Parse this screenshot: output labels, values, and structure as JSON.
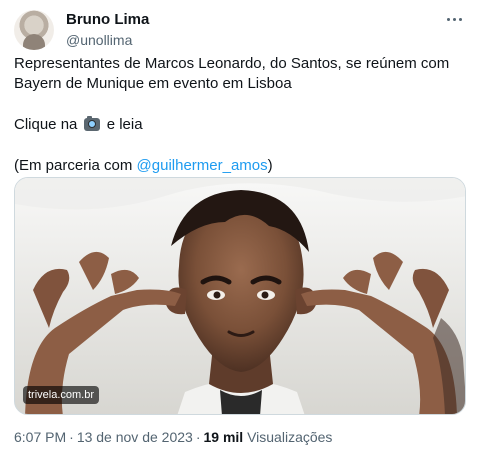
{
  "post": {
    "author_name": "Bruno Lima",
    "author_handle": "@unollima",
    "text_line1": "Representantes de Marcos Leonardo, do Santos, se reúnem com Bayern de Munique em evento em Lisboa",
    "text_line2_prefix": "Clique na ",
    "text_line2_suffix": " e leia",
    "text_line3_prefix": "(Em parceria com ",
    "text_line3_mention": "@guilhermer_amos",
    "text_line3_suffix": ")",
    "media_watermark": "trivela.com.br",
    "time": "6:07 PM",
    "date": "13 de nov de 2023",
    "views_count": "19 mil",
    "views_label": "Visualizações"
  },
  "icons": {
    "avatar": "avatar",
    "more": "more-icon",
    "camera": "camera-emoji-icon"
  },
  "colors": {
    "text": "#0f1419",
    "secondary": "#536471",
    "link": "#1d9bf0",
    "border": "#cfd9de"
  }
}
